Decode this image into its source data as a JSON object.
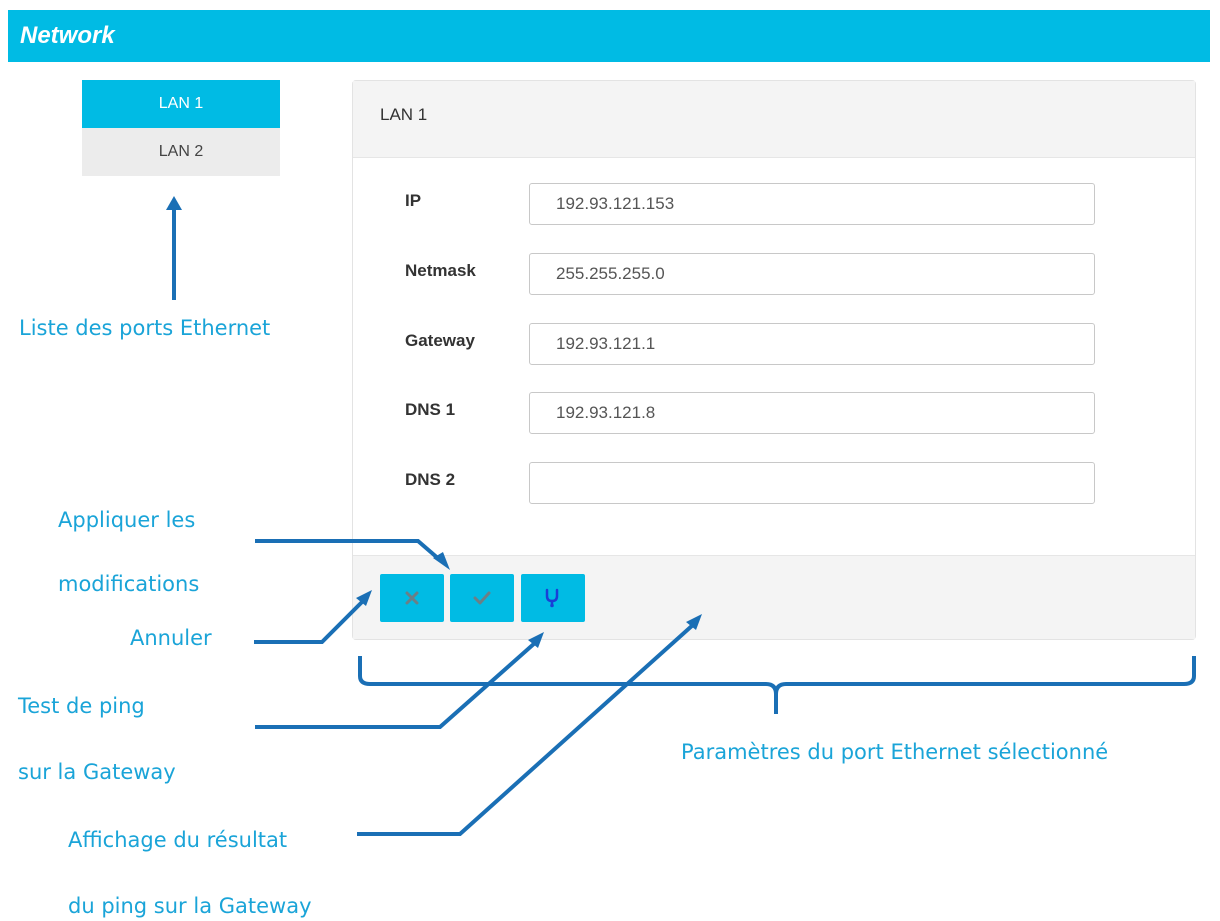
{
  "header": {
    "title": "Network"
  },
  "ports": [
    {
      "label": "LAN 1",
      "active": true
    },
    {
      "label": "LAN 2",
      "active": false
    }
  ],
  "panel": {
    "title": "LAN 1",
    "fields": [
      {
        "label": "IP",
        "value": "192.93.121.153"
      },
      {
        "label": "Netmask",
        "value": "255.255.255.0"
      },
      {
        "label": "Gateway",
        "value": "192.93.121.1"
      },
      {
        "label": "DNS 1",
        "value": "192.93.121.8"
      },
      {
        "label": "DNS 2",
        "value": ""
      }
    ],
    "buttons": [
      {
        "name": "cancel-button",
        "icon": "close-icon"
      },
      {
        "name": "apply-button",
        "icon": "check-icon"
      },
      {
        "name": "ping-test-button",
        "icon": "stethoscope-icon"
      }
    ]
  },
  "colors": {
    "accent": "#00bbe4",
    "annotation": "#1aa4d8",
    "arrow": "#1a6fb5"
  },
  "annotations": {
    "port_list": "Liste des ports Ethernet",
    "apply_line1": "Appliquer les",
    "apply_line2": "modifications",
    "cancel": "Annuler",
    "ping_line1": "Test de ping",
    "ping_line2": "sur la Gateway",
    "result_line1": "Affichage du résultat",
    "result_line2": "du ping sur la Gateway",
    "params": "Paramètres du port Ethernet sélectionné"
  }
}
